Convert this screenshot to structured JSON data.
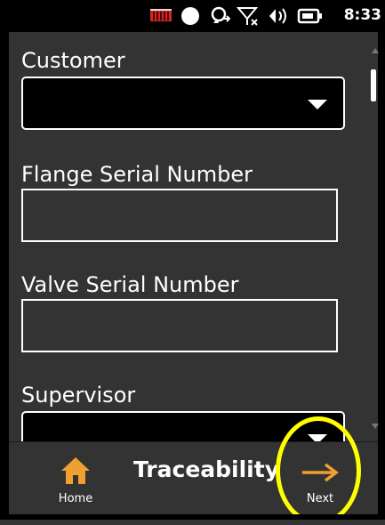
{
  "status_bar": {
    "time": "8:33",
    "icons": [
      "battery-meter-icon",
      "record-icon",
      "sync-icon",
      "no-signal-icon",
      "volume-icon",
      "battery-icon"
    ]
  },
  "form": {
    "customer_label": "Customer",
    "customer_value": "",
    "flange_label": "Flange Serial Number",
    "flange_value": "",
    "valve_label": "Valve Serial Number",
    "valve_value": "",
    "supervisor_label": "Supervisor",
    "supervisor_value": ""
  },
  "bottom_bar": {
    "home_label": "Home",
    "title": "Traceability",
    "next_label": "Next"
  },
  "colors": {
    "background": "#333333",
    "next_arrow": "#f0a030",
    "home_icon": "#f0a030",
    "highlight": "#ffff00"
  }
}
